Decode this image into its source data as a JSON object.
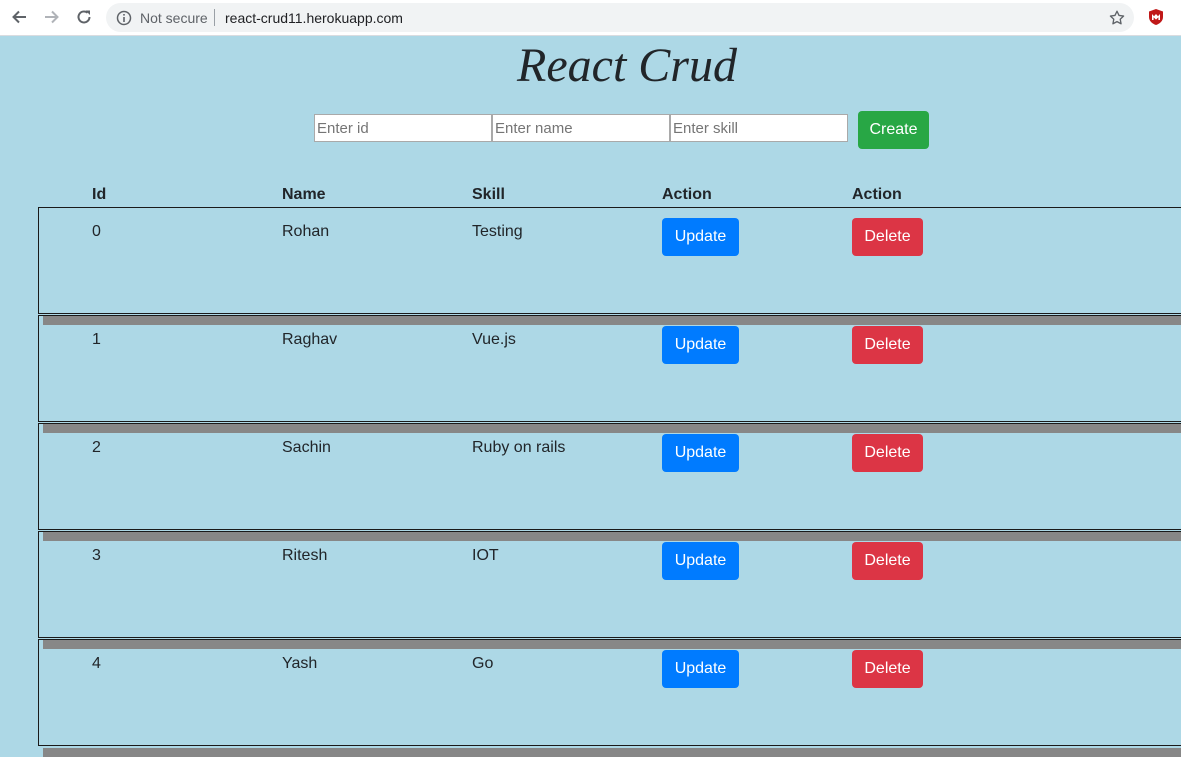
{
  "browser": {
    "security_label": "Not secure",
    "url": "react-crud11.herokuapp.com"
  },
  "page": {
    "title": "React Crud"
  },
  "form": {
    "id_placeholder": "Enter id",
    "name_placeholder": "Enter name",
    "skill_placeholder": "Enter skill",
    "create_label": "Create"
  },
  "table": {
    "headers": [
      "Id",
      "Name",
      "Skill",
      "Action",
      "Action"
    ],
    "rows": [
      {
        "id": "0",
        "name": "Rohan",
        "skill": "Testing",
        "update": "Update",
        "delete": "Delete"
      },
      {
        "id": "1",
        "name": "Raghav",
        "skill": "Vue.js",
        "update": "Update",
        "delete": "Delete"
      },
      {
        "id": "2",
        "name": "Sachin",
        "skill": "Ruby on rails",
        "update": "Update",
        "delete": "Delete"
      },
      {
        "id": "3",
        "name": "Ritesh",
        "skill": "IOT",
        "update": "Update",
        "delete": "Delete"
      },
      {
        "id": "4",
        "name": "Yash",
        "skill": "Go",
        "update": "Update",
        "delete": "Delete"
      }
    ]
  },
  "colors": {
    "background": "#add8e6",
    "create": "#28a745",
    "update": "#007bff",
    "delete": "#dc3545"
  },
  "icons": [
    "back-arrow-icon",
    "forward-arrow-icon",
    "reload-icon",
    "info-icon",
    "star-icon",
    "mcafee-extension-icon"
  ]
}
